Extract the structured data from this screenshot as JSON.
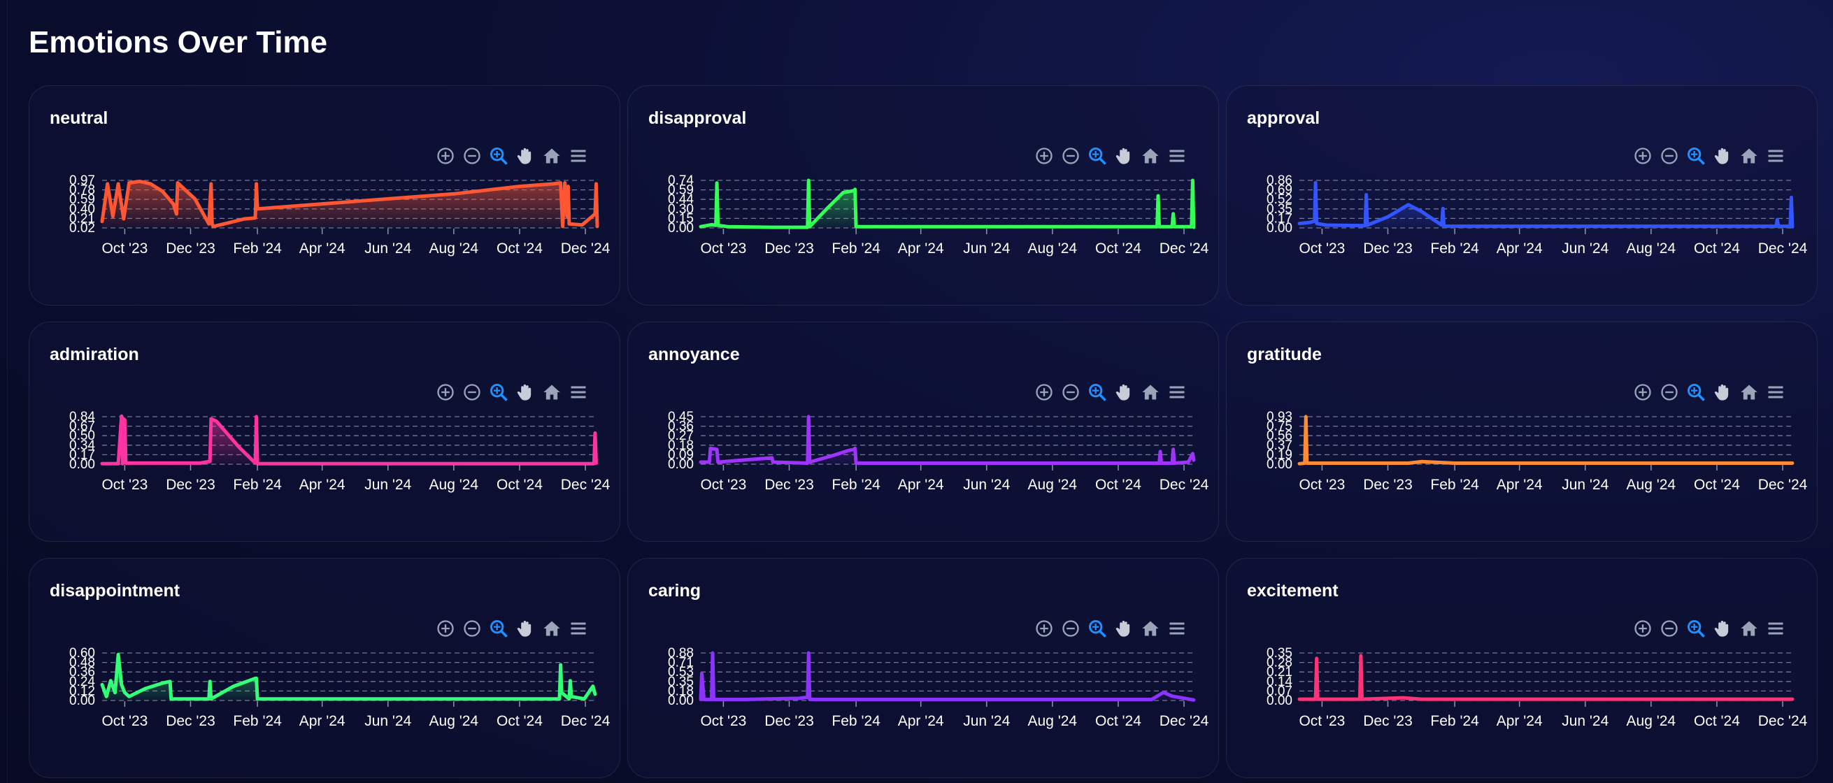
{
  "page": {
    "title": "Emotions Over Time"
  },
  "x_ticks": [
    "Oct '23",
    "Dec '23",
    "Feb '24",
    "Apr '24",
    "Jun '24",
    "Aug '24",
    "Oct '24",
    "Dec '24"
  ],
  "toolbar": [
    "zoom-in-icon",
    "zoom-out-icon",
    "zoom-selection-icon",
    "pan-hand-icon",
    "home-reset-icon",
    "menu-icon"
  ],
  "chart_data": [
    {
      "type": "area",
      "name": "neutral",
      "title": "neutral",
      "color": "#ff5733",
      "x_ticks": [
        "Oct '23",
        "Dec '23",
        "Feb '24",
        "Apr '24",
        "Jun '24",
        "Aug '24",
        "Oct '24",
        "Dec '24"
      ],
      "y_ticks": [
        "0.97",
        "0.78",
        "0.59",
        "0.40",
        "0.21",
        "0.02"
      ],
      "ylim": [
        0.02,
        0.97
      ],
      "x": [
        "2023-09-10",
        "2023-09-15",
        "2023-09-20",
        "2023-09-25",
        "2023-09-30",
        "2023-10-05",
        "2023-10-15",
        "2023-10-25",
        "2023-11-05",
        "2023-11-15",
        "2023-11-18",
        "2023-11-19",
        "2023-11-20",
        "2023-12-05",
        "2023-12-18",
        "2023-12-20",
        "2023-12-21",
        "2023-12-22",
        "2024-01-05",
        "2024-01-20",
        "2024-01-30",
        "2024-01-31",
        "2024-02-01",
        "2024-05-01",
        "2024-08-01",
        "2024-10-01",
        "2024-11-01",
        "2024-11-08",
        "2024-11-10",
        "2024-11-12",
        "2024-11-14",
        "2024-11-15",
        "2024-11-16",
        "2024-11-28",
        "2024-12-10",
        "2024-12-11",
        "2024-12-12"
      ],
      "y": [
        0.15,
        0.9,
        0.25,
        0.9,
        0.2,
        0.92,
        0.95,
        0.9,
        0.75,
        0.5,
        0.3,
        0.92,
        0.9,
        0.6,
        0.1,
        0.9,
        0.1,
        0.05,
        0.12,
        0.2,
        0.22,
        0.9,
        0.4,
        0.55,
        0.7,
        0.85,
        0.9,
        0.92,
        0.05,
        0.92,
        0.25,
        0.85,
        0.1,
        0.08,
        0.3,
        0.9,
        0.05
      ]
    },
    {
      "type": "area",
      "name": "disapproval",
      "title": "disapproval",
      "color": "#33ff57",
      "x_ticks": [
        "Oct '23",
        "Dec '23",
        "Feb '24",
        "Apr '24",
        "Jun '24",
        "Aug '24",
        "Oct '24",
        "Dec '24"
      ],
      "y_ticks": [
        "0.74",
        "0.59",
        "0.44",
        "0.30",
        "0.15",
        "0.00"
      ],
      "ylim": [
        0,
        0.74
      ],
      "x": [
        "2023-09-10",
        "2023-09-20",
        "2023-09-24",
        "2023-09-25",
        "2023-09-26",
        "2023-10-05",
        "2023-11-15",
        "2023-12-18",
        "2023-12-19",
        "2023-12-20",
        "2024-01-05",
        "2024-01-20",
        "2024-01-30",
        "2024-01-31",
        "2024-02-01",
        "2024-06-01",
        "2024-11-01",
        "2024-11-06",
        "2024-11-07",
        "2024-11-08",
        "2024-11-20",
        "2024-11-21",
        "2024-11-22",
        "2024-12-08",
        "2024-12-09",
        "2024-12-10"
      ],
      "y": [
        0.02,
        0.05,
        0.04,
        0.7,
        0.04,
        0.02,
        0.01,
        0.01,
        0.74,
        0.02,
        0.3,
        0.55,
        0.58,
        0.6,
        0.02,
        0.02,
        0.02,
        0.02,
        0.5,
        0.02,
        0.02,
        0.22,
        0.02,
        0.02,
        0.74,
        0.01
      ]
    },
    {
      "type": "area",
      "name": "approval",
      "title": "approval",
      "color": "#3355ff",
      "x_ticks": [
        "Oct '23",
        "Dec '23",
        "Feb '24",
        "Apr '24",
        "Jun '24",
        "Aug '24",
        "Oct '24",
        "Dec '24"
      ],
      "y_ticks": [
        "0.86",
        "0.69",
        "0.52",
        "0.35",
        "0.17",
        "0.00"
      ],
      "ylim": [
        0,
        0.86
      ],
      "x": [
        "2023-09-10",
        "2023-09-20",
        "2023-09-24",
        "2023-09-25",
        "2023-09-26",
        "2023-10-05",
        "2023-11-10",
        "2023-11-11",
        "2023-11-12",
        "2023-12-01",
        "2023-12-20",
        "2024-01-01",
        "2024-01-20",
        "2024-01-21",
        "2024-01-22",
        "2024-04-01",
        "2024-07-01",
        "2024-10-01",
        "2024-11-25",
        "2024-11-26",
        "2024-11-27",
        "2024-12-08",
        "2024-12-09",
        "2024-12-10"
      ],
      "y": [
        0.08,
        0.1,
        0.12,
        0.82,
        0.08,
        0.05,
        0.04,
        0.6,
        0.05,
        0.2,
        0.42,
        0.3,
        0.05,
        0.35,
        0.03,
        0.03,
        0.03,
        0.03,
        0.03,
        0.15,
        0.03,
        0.03,
        0.55,
        0.02
      ]
    },
    {
      "type": "area",
      "name": "admiration",
      "title": "admiration",
      "color": "#ff33a1",
      "x_ticks": [
        "Oct '23",
        "Dec '23",
        "Feb '24",
        "Apr '24",
        "Jun '24",
        "Aug '24",
        "Oct '24",
        "Dec '24"
      ],
      "y_ticks": [
        "0.84",
        "0.67",
        "0.50",
        "0.34",
        "0.17",
        "0.00"
      ],
      "ylim": [
        0,
        0.84
      ],
      "x": [
        "2023-09-10",
        "2023-09-25",
        "2023-09-28",
        "2023-09-29",
        "2023-09-30",
        "2023-10-01",
        "2023-10-02",
        "2023-11-15",
        "2023-12-10",
        "2023-12-19",
        "2023-12-20",
        "2023-12-25",
        "2024-01-15",
        "2024-01-30",
        "2024-01-31",
        "2024-02-01",
        "2024-06-01",
        "2024-12-09",
        "2024-12-10",
        "2024-12-11"
      ],
      "y": [
        0.01,
        0.01,
        0.85,
        0.01,
        0.8,
        0.78,
        0.02,
        0.02,
        0.02,
        0.05,
        0.8,
        0.76,
        0.3,
        0.02,
        0.84,
        0.01,
        0.01,
        0.01,
        0.55,
        0.02
      ]
    },
    {
      "type": "area",
      "name": "annoyance",
      "title": "annoyance",
      "color": "#a133ff",
      "x_ticks": [
        "Oct '23",
        "Dec '23",
        "Feb '24",
        "Apr '24",
        "Jun '24",
        "Aug '24",
        "Oct '24",
        "Dec '24"
      ],
      "y_ticks": [
        "0.45",
        "0.36",
        "0.27",
        "0.18",
        "0.09",
        "0.00"
      ],
      "ylim": [
        0,
        0.45
      ],
      "x": [
        "2023-09-10",
        "2023-09-18",
        "2023-09-19",
        "2023-09-25",
        "2023-09-26",
        "2023-10-20",
        "2023-11-15",
        "2023-11-16",
        "2023-12-18",
        "2023-12-19",
        "2023-12-20",
        "2024-01-10",
        "2024-01-25",
        "2024-01-30",
        "2024-01-31",
        "2024-02-01",
        "2024-06-01",
        "2024-11-01",
        "2024-11-08",
        "2024-11-09",
        "2024-11-10",
        "2024-11-20",
        "2024-11-21",
        "2024-11-22",
        "2024-12-05",
        "2024-12-09",
        "2024-12-10"
      ],
      "y": [
        0.02,
        0.02,
        0.15,
        0.14,
        0.02,
        0.04,
        0.06,
        0.02,
        0.01,
        0.45,
        0.02,
        0.08,
        0.13,
        0.14,
        0.15,
        0.01,
        0.01,
        0.01,
        0.01,
        0.12,
        0.01,
        0.01,
        0.14,
        0.01,
        0.02,
        0.1,
        0.04
      ]
    },
    {
      "type": "area",
      "name": "gratitude",
      "title": "gratitude",
      "color": "#ff8c33",
      "x_ticks": [
        "Oct '23",
        "Dec '23",
        "Feb '24",
        "Apr '24",
        "Jun '24",
        "Aug '24",
        "Oct '24",
        "Dec '24"
      ],
      "y_ticks": [
        "0.93",
        "0.75",
        "0.56",
        "0.37",
        "0.19",
        "0.00"
      ],
      "ylim": [
        0,
        0.93
      ],
      "x": [
        "2023-09-10",
        "2023-09-15",
        "2023-09-16",
        "2023-09-17",
        "2023-10-20",
        "2023-12-20",
        "2024-01-01",
        "2024-02-01",
        "2024-06-01",
        "2024-12-10"
      ],
      "y": [
        0.01,
        0.02,
        0.93,
        0.02,
        0.02,
        0.02,
        0.05,
        0.02,
        0.02,
        0.02
      ]
    },
    {
      "type": "area",
      "name": "disappointment",
      "title": "disappointment",
      "color": "#33ff77",
      "x_ticks": [
        "Oct '23",
        "Dec '23",
        "Feb '24",
        "Apr '24",
        "Jun '24",
        "Aug '24",
        "Oct '24",
        "Dec '24"
      ],
      "y_ticks": [
        "0.60",
        "0.48",
        "0.36",
        "0.24",
        "0.12",
        "0.00"
      ],
      "ylim": [
        0,
        0.6
      ],
      "x": [
        "2023-09-10",
        "2023-09-14",
        "2023-09-18",
        "2023-09-22",
        "2023-09-25",
        "2023-09-28",
        "2023-10-01",
        "2023-10-05",
        "2023-10-20",
        "2023-11-05",
        "2023-11-12",
        "2023-11-13",
        "2023-12-18",
        "2023-12-19",
        "2023-12-20",
        "2024-01-10",
        "2024-01-30",
        "2024-01-31",
        "2024-02-01",
        "2024-06-01",
        "2024-11-01",
        "2024-11-07",
        "2024-11-08",
        "2024-11-09",
        "2024-11-16",
        "2024-11-17",
        "2024-11-18",
        "2024-11-30",
        "2024-12-08",
        "2024-12-10"
      ],
      "y": [
        0.2,
        0.05,
        0.25,
        0.1,
        0.58,
        0.2,
        0.1,
        0.05,
        0.15,
        0.22,
        0.24,
        0.02,
        0.02,
        0.24,
        0.02,
        0.18,
        0.28,
        0.28,
        0.02,
        0.02,
        0.02,
        0.02,
        0.45,
        0.1,
        0.02,
        0.25,
        0.05,
        0.02,
        0.18,
        0.08
      ]
    },
    {
      "type": "area",
      "name": "caring",
      "title": "caring",
      "color": "#8c33ff",
      "x_ticks": [
        "Oct '23",
        "Dec '23",
        "Feb '24",
        "Apr '24",
        "Jun '24",
        "Aug '24",
        "Oct '24",
        "Dec '24"
      ],
      "y_ticks": [
        "0.88",
        "0.71",
        "0.53",
        "0.35",
        "0.18",
        "0.00"
      ],
      "ylim": [
        0,
        0.88
      ],
      "x": [
        "2023-09-10",
        "2023-09-11",
        "2023-09-13",
        "2023-09-20",
        "2023-09-21",
        "2023-09-22",
        "2023-10-20",
        "2023-12-10",
        "2023-12-18",
        "2023-12-19",
        "2023-12-20",
        "2024-06-01",
        "2024-11-01",
        "2024-11-12",
        "2024-11-20",
        "2024-12-10"
      ],
      "y": [
        0.02,
        0.5,
        0.02,
        0.02,
        0.88,
        0.02,
        0.02,
        0.04,
        0.06,
        0.88,
        0.02,
        0.02,
        0.02,
        0.15,
        0.08,
        0.01
      ]
    },
    {
      "type": "area",
      "name": "excitement",
      "title": "excitement",
      "color": "#ff3377",
      "x_ticks": [
        "Oct '23",
        "Dec '23",
        "Feb '24",
        "Apr '24",
        "Jun '24",
        "Aug '24",
        "Oct '24",
        "Dec '24"
      ],
      "y_ticks": [
        "0.35",
        "0.28",
        "0.21",
        "0.14",
        "0.07",
        "0.00"
      ],
      "ylim": [
        0,
        0.35
      ],
      "x": [
        "2023-09-10",
        "2023-09-25",
        "2023-09-26",
        "2023-09-27",
        "2023-11-05",
        "2023-11-06",
        "2023-11-07",
        "2023-12-15",
        "2024-01-01",
        "2024-02-01",
        "2024-06-01",
        "2024-12-10"
      ],
      "y": [
        0.01,
        0.01,
        0.31,
        0.01,
        0.01,
        0.33,
        0.01,
        0.02,
        0.01,
        0.01,
        0.01,
        0.01
      ]
    }
  ]
}
